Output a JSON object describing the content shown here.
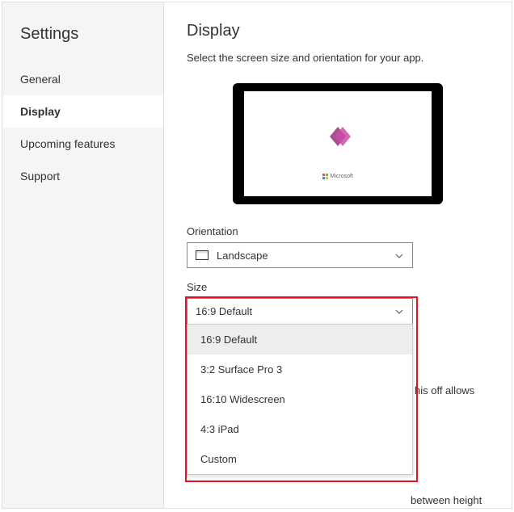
{
  "sidebar": {
    "title": "Settings",
    "items": [
      {
        "label": "General",
        "active": false
      },
      {
        "label": "Display",
        "active": true
      },
      {
        "label": "Upcoming features",
        "active": false
      },
      {
        "label": "Support",
        "active": false
      }
    ]
  },
  "main": {
    "title": "Display",
    "subtitle": "Select the screen size and orientation for your app.",
    "preview_brand": "Microsoft",
    "orientation": {
      "label": "Orientation",
      "value": "Landscape"
    },
    "size": {
      "label": "Size",
      "value": "16:9 Default",
      "options": [
        "16:9 Default",
        "3:2 Surface Pro 3",
        "16:10 Widescreen",
        "4:3 iPad",
        "Custom"
      ]
    },
    "bg_fragments": {
      "frag1": "his off allows",
      "frag2": "between height"
    }
  }
}
